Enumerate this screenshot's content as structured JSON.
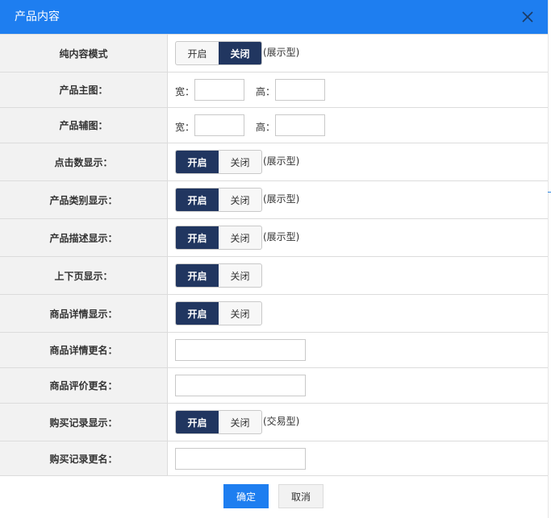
{
  "dialog": {
    "title": "产品内容",
    "close_icon": "close-icon"
  },
  "rows": {
    "pure_mode": {
      "label": "纯内容模式",
      "on": "开启",
      "off": "关闭",
      "selected": "关闭",
      "hint": "(展示型)"
    },
    "main_image": {
      "label": "产品主图：",
      "width_label": "宽：",
      "height_label": "高：",
      "width_value": "",
      "height_value": ""
    },
    "sub_image": {
      "label": "产品辅图：",
      "width_label": "宽：",
      "height_label": "高：",
      "width_value": "",
      "height_value": ""
    },
    "click_count": {
      "label": "点击数显示：",
      "on": "开启",
      "off": "关闭",
      "selected": "开启",
      "hint": "(展示型)"
    },
    "category": {
      "label": "产品类别显示：",
      "on": "开启",
      "off": "关闭",
      "selected": "开启",
      "hint": "(展示型)"
    },
    "description": {
      "label": "产品描述显示：",
      "on": "开启",
      "off": "关闭",
      "selected": "开启",
      "hint": "(展示型)"
    },
    "pagination": {
      "label": "上下页显示：",
      "on": "开启",
      "off": "关闭",
      "selected": "开启"
    },
    "detail": {
      "label": "商品详情显示：",
      "on": "开启",
      "off": "关闭",
      "selected": "开启"
    },
    "detail_rename": {
      "label": "商品详情更名：",
      "value": ""
    },
    "review_rename": {
      "label": "商品评价更名：",
      "value": ""
    },
    "purchase_record": {
      "label": "购买记录显示：",
      "on": "开启",
      "off": "关闭",
      "selected": "开启",
      "hint": "(交易型)"
    },
    "purchase_rename": {
      "label": "购买记录更名：",
      "value": ""
    }
  },
  "footer": {
    "ok_label": "确定",
    "cancel_label": "取消"
  },
  "colors": {
    "title_bar": "#1e7ef0",
    "toggle_active": "#213660",
    "label_bg": "#f2f2f2"
  }
}
